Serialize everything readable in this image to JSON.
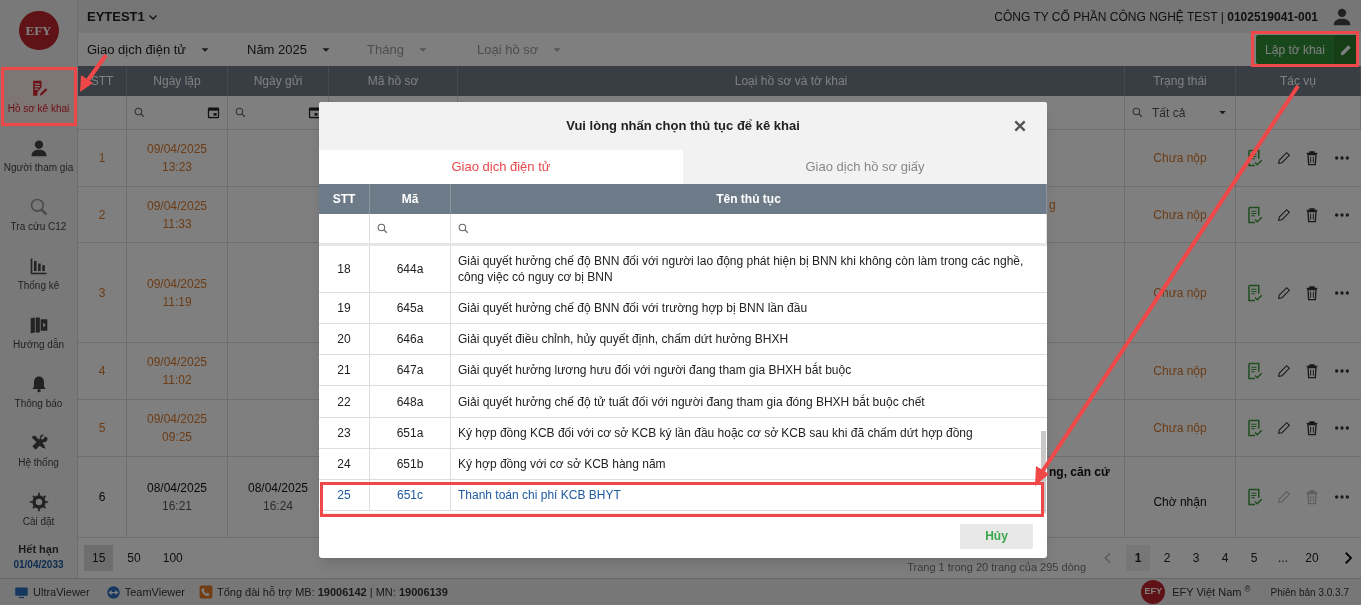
{
  "logo": "EFY",
  "top_bar": {
    "account": "EYTEST1",
    "company": "CÔNG TY CỔ PHẦN CÔNG NGHỆ TEST | **0102519041-001**"
  },
  "sidebar": {
    "items": [
      {
        "label": "Hồ sơ kê khai",
        "selected": true,
        "highlighted": true
      },
      {
        "label": "Người tham gia",
        "selected": false,
        "highlighted": false
      },
      {
        "label": "Tra cứu C12",
        "selected": false,
        "highlighted": false
      },
      {
        "label": "Thống kê",
        "selected": false,
        "highlighted": false
      },
      {
        "label": "Hướng dẫn",
        "selected": false,
        "highlighted": false
      },
      {
        "label": "Thông báo",
        "selected": false,
        "highlighted": false
      },
      {
        "label": "Hệ thống",
        "selected": false,
        "highlighted": false
      },
      {
        "label": "Cài đặt",
        "selected": false,
        "highlighted": false
      }
    ],
    "expiry": {
      "label": "Hết hạn",
      "date": "01/04/2033"
    }
  },
  "filters": [
    {
      "value": "Giao dịch điện tử"
    },
    {
      "value": "Năm 2025"
    },
    {
      "placeholder": "Tháng"
    },
    {
      "placeholder": "Loại hồ sơ"
    }
  ],
  "create_button": {
    "label": "Lập tờ khai",
    "highlighted": true
  },
  "table": {
    "columns": [
      "STT",
      "Ngày lập",
      "Ngày gửi",
      "Mã hồ sơ",
      "Loại hồ sơ và tờ khai",
      "Trạng thái",
      "Tác vụ"
    ],
    "status_filter": "Tất cả",
    "rows": [
      {
        "stt": "1",
        "created_date": "09/04/2025",
        "created_time": "13:23",
        "status": "Chưa nộp",
        "kind": "draft"
      },
      {
        "stt": "2",
        "created_date": "09/04/2025",
        "created_time": "11:33",
        "type_fragment": "g",
        "status": "Chưa nộp",
        "kind": "draft"
      },
      {
        "stt": "3",
        "created_date": "09/04/2025",
        "created_time": "11:19",
        "status": "Chưa nộp",
        "kind": "draft"
      },
      {
        "stt": "4",
        "created_date": "09/04/2025",
        "created_time": "11:02",
        "status": "Chưa nộp",
        "kind": "draft"
      },
      {
        "stt": "5",
        "created_date": "09/04/2025",
        "created_time": "09:25",
        "status": "Chưa nộp",
        "kind": "draft"
      },
      {
        "stt": "6",
        "created_date": "08/04/2025",
        "created_time": "16:21",
        "sent_date": "08/04/2025",
        "sent_time": "16:24",
        "type_fragment": "ng, căn cứ",
        "status": "Chờ nhận",
        "kind": "submitted"
      }
    ]
  },
  "pagination": {
    "page_sizes": [
      {
        "label": "15",
        "selected": true
      },
      {
        "label": "50",
        "selected": false
      },
      {
        "label": "100",
        "selected": false
      }
    ],
    "summary": "Trang 1 trong 20 trang của 295 dòng",
    "pages": [
      {
        "label": "1",
        "selected": true
      },
      {
        "label": "2",
        "selected": false
      },
      {
        "label": "3",
        "selected": false
      },
      {
        "label": "4",
        "selected": false
      },
      {
        "label": "5",
        "selected": false
      },
      {
        "label": "...",
        "selected": false
      },
      {
        "label": "20",
        "selected": false
      }
    ]
  },
  "footer": {
    "tools": [
      "UltraViewer",
      "TeamViewer"
    ],
    "hotline": "Tổng đài hỗ trợ MB: **19006142** | MN: **19006139**",
    "brand_logo": "EFY",
    "brand": "EFY Việt Nam $^{®}$",
    "version": "Phiên bản 3.0.3.7"
  },
  "modal": {
    "title": "Vui lòng nhấn chọn thủ tục để kê khai",
    "tabs": [
      {
        "label": "Giao dịch điện tử",
        "selected": true
      },
      {
        "label": "Giao dịch hồ sơ giấy",
        "selected": false
      }
    ],
    "columns": [
      "STT",
      "Mã",
      "Tên thủ tục"
    ],
    "rows": [
      {
        "stt": "18",
        "code": "644a",
        "name": "Giải quyết hưởng chế độ BNN đối với người lao động phát hiện bị BNN khi không còn làm trong các nghề, công việc có nguy cơ bị BNN",
        "selected": false,
        "highlighted": false
      },
      {
        "stt": "19",
        "code": "645a",
        "name": "Giải quyết hưởng chế độ BNN đối với trường hợp bị BNN lần đầu",
        "selected": false,
        "highlighted": false
      },
      {
        "stt": "20",
        "code": "646a",
        "name": "Giải quyết điều chỉnh, hủy quyết định, chấm dứt hưởng BHXH",
        "selected": false,
        "highlighted": false
      },
      {
        "stt": "21",
        "code": "647a",
        "name": "Giải quyết hưởng lương hưu đối với người đang tham gia BHXH bắt buộc",
        "selected": false,
        "highlighted": false
      },
      {
        "stt": "22",
        "code": "648a",
        "name": "Giải quyết hưởng chế độ tử tuất đối với người đang tham gia đóng BHXH bắt buộc chết",
        "selected": false,
        "highlighted": false
      },
      {
        "stt": "23",
        "code": "651a",
        "name": "Ký hợp đồng KCB đối với cơ sở KCB ký lần đầu hoặc cơ sở KCB sau khi đã chấm dứt hợp đồng",
        "selected": false,
        "highlighted": false
      },
      {
        "stt": "24",
        "code": "651b",
        "name": "Ký hợp đồng với cơ sở KCB hàng năm",
        "selected": false,
        "highlighted": false
      },
      {
        "stt": "25",
        "code": "651c",
        "name": "Thanh toán chi phí KCB BHYT",
        "selected": true,
        "highlighted": true
      }
    ],
    "cancel_button": "Hủy"
  }
}
